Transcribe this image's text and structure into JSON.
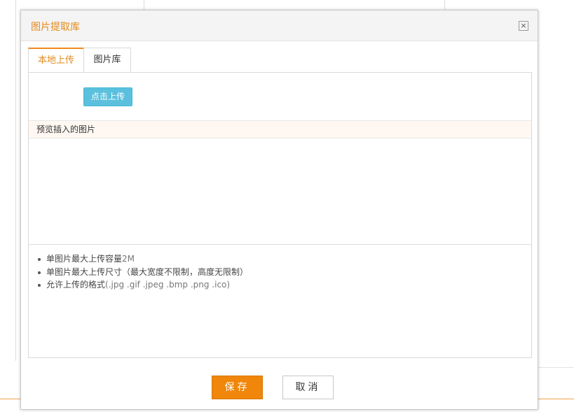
{
  "dialog": {
    "title": "图片提取库",
    "close_icon": "close-icon"
  },
  "tabs": [
    {
      "label": "本地上传",
      "active": true
    },
    {
      "label": "图片库",
      "active": false
    }
  ],
  "upload": {
    "button_label": "点击上传"
  },
  "preview": {
    "header": "预览插入的图片"
  },
  "notes": {
    "line1_text": "单图片最大上传容量",
    "line1_value": "2M",
    "line2": "单图片最大上传尺寸（最大宽度不限制，高度无限制）",
    "line3_text": "允许上传的格式",
    "line3_formats": "(.jpg .gif .jpeg .bmp .png .ico)"
  },
  "footer": {
    "save_label": "保存",
    "cancel_label": "取消"
  },
  "colors": {
    "accent": "#f0860a",
    "title_orange": "#e38a1c",
    "upload_blue": "#5bc0de"
  }
}
